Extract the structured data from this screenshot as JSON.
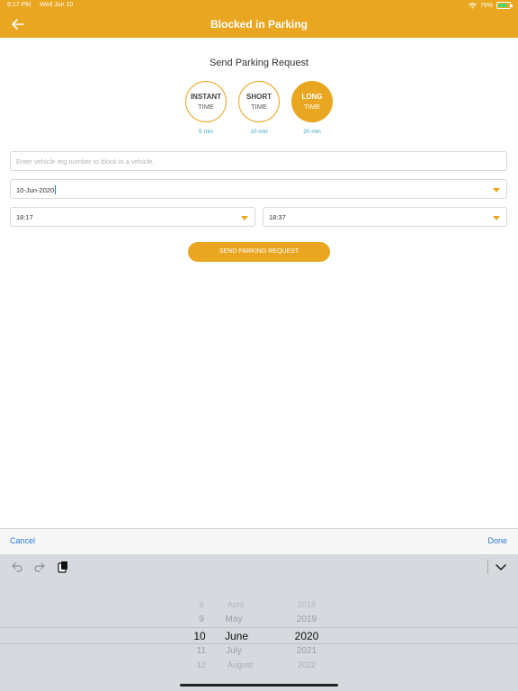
{
  "status_bar": {
    "time": "6:17 PM",
    "date": "Wed Jun 10",
    "battery": "79%",
    "battery_level": 0.79
  },
  "nav": {
    "title": "Blocked in Parking",
    "back_icon": "back-arrow-icon"
  },
  "main": {
    "title": "Send Parking Request",
    "options": [
      {
        "line1": "INSTANT",
        "line2": "TIME",
        "duration": "5 min",
        "active": false
      },
      {
        "line1": "SHORT",
        "line2": "TIME",
        "duration": "10 min",
        "active": false
      },
      {
        "line1": "LONG",
        "line2": "TIME",
        "duration": "20 min",
        "active": true
      }
    ],
    "vehicle_placeholder": "Enter vehicle reg number to block in a vehicle.",
    "date_value": "10-Jun-2020",
    "start_time": "18:17",
    "end_time": "18:37",
    "send_label": "SEND PARKING REQUEST"
  },
  "picker_toolbar": {
    "cancel": "Cancel",
    "done": "Done"
  },
  "date_picker": {
    "days": [
      "8",
      "9",
      "10",
      "11",
      "12"
    ],
    "months": [
      "April",
      "May",
      "June",
      "July",
      "August"
    ],
    "years": [
      "2018",
      "2019",
      "2020",
      "2021",
      "2022"
    ],
    "selected": {
      "day": "10",
      "month": "June",
      "year": "2020"
    }
  },
  "colors": {
    "accent": "#E9A620",
    "link": "#2a79d6",
    "duration": "#3AA6B9"
  }
}
